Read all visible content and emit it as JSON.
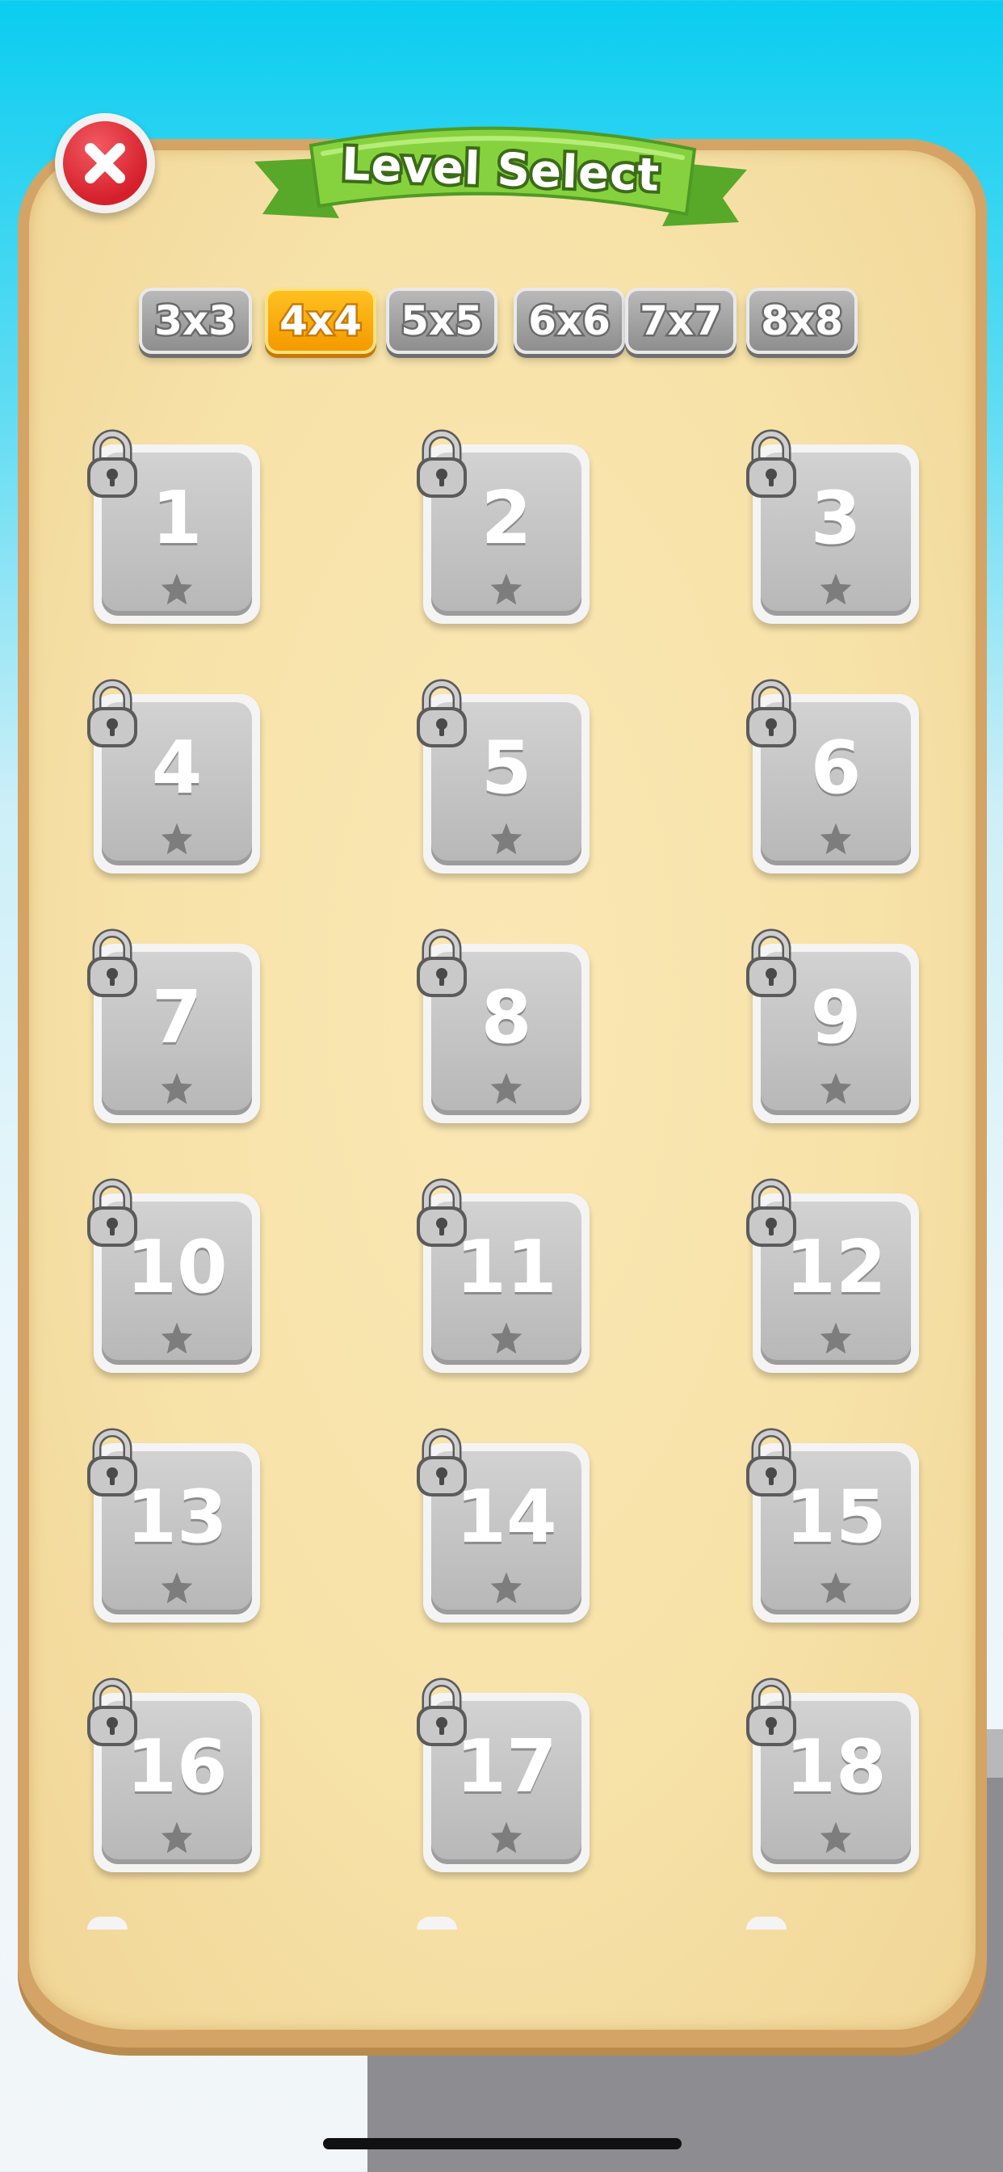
{
  "title": "Level Select",
  "close_icon": "close-icon",
  "size_tabs": [
    {
      "label": "3x3",
      "active": false
    },
    {
      "label": "4x4",
      "active": true
    },
    {
      "label": "5x5",
      "active": false
    },
    {
      "label": "6x6",
      "active": false
    },
    {
      "label": "7x7",
      "active": false
    },
    {
      "label": "8x8",
      "active": false
    }
  ],
  "levels": [
    {
      "number": "1",
      "locked": true,
      "stars": 0
    },
    {
      "number": "2",
      "locked": true,
      "stars": 0
    },
    {
      "number": "3",
      "locked": true,
      "stars": 0
    },
    {
      "number": "4",
      "locked": true,
      "stars": 0
    },
    {
      "number": "5",
      "locked": true,
      "stars": 0
    },
    {
      "number": "6",
      "locked": true,
      "stars": 0
    },
    {
      "number": "7",
      "locked": true,
      "stars": 0
    },
    {
      "number": "8",
      "locked": true,
      "stars": 0
    },
    {
      "number": "9",
      "locked": true,
      "stars": 0
    },
    {
      "number": "10",
      "locked": true,
      "stars": 0
    },
    {
      "number": "11",
      "locked": true,
      "stars": 0
    },
    {
      "number": "12",
      "locked": true,
      "stars": 0
    },
    {
      "number": "13",
      "locked": true,
      "stars": 0
    },
    {
      "number": "14",
      "locked": true,
      "stars": 0
    },
    {
      "number": "15",
      "locked": true,
      "stars": 0
    },
    {
      "number": "16",
      "locked": true,
      "stars": 0
    },
    {
      "number": "17",
      "locked": true,
      "stars": 0
    },
    {
      "number": "18",
      "locked": true,
      "stars": 0
    }
  ],
  "colors": {
    "sky": "#0bcdf0",
    "board": "#f7e2a8",
    "board_border": "#d3a465",
    "ribbon": "#7ccc3a",
    "active_tab": "#f7a800",
    "inactive_tab": "#9e9e9e",
    "close_button": "#e0303a"
  }
}
